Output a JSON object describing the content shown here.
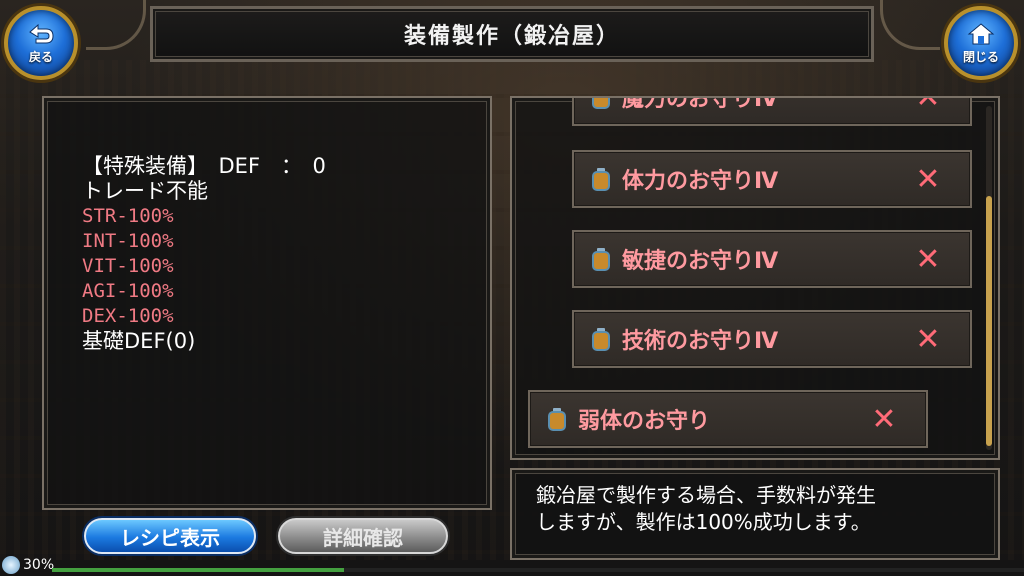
{
  "header": {
    "title": "装備製作（鍛冶屋）"
  },
  "nav": {
    "back_label": "戻る",
    "close_label": "閉じる"
  },
  "details": {
    "line1": "【特殊装備】　DEF　：　0",
    "line2": "トレード不能",
    "penalties": [
      "STR-100%",
      "INT-100%",
      "VIT-100%",
      "AGI-100%",
      "DEX-100%"
    ],
    "base_def": "基礎DEF(0)"
  },
  "items": [
    {
      "name": "魔力のお守りⅣ",
      "remove": "✕"
    },
    {
      "name": "体力のお守りⅣ",
      "remove": "✕"
    },
    {
      "name": "敏捷のお守りⅣ",
      "remove": "✕"
    },
    {
      "name": "技術のお守りⅣ",
      "remove": "✕"
    },
    {
      "name": "弱体のお守り",
      "remove": "✕"
    }
  ],
  "message": {
    "line1": "鍛冶屋で製作する場合、手数料が発生",
    "line2": "しますが、製作は100%成功します。"
  },
  "buttons": {
    "recipe": "レシピ表示",
    "details": "詳細確認"
  },
  "status": {
    "percent_label": "30%",
    "progress": 0.3
  },
  "colors": {
    "accent_blue": "#1e6fd8",
    "penalty_red": "#f07a84",
    "item_text": "#ff9aa0",
    "gold_trim": "#b8902c"
  }
}
